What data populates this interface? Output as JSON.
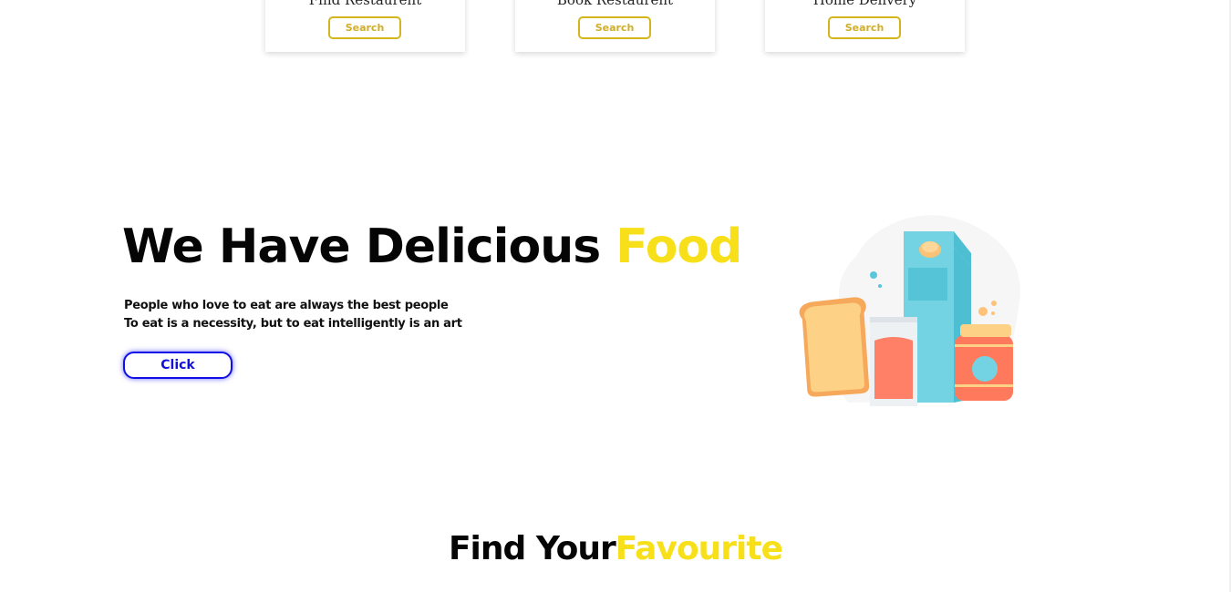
{
  "services": [
    {
      "title": "Find Restaurent",
      "button": "Search"
    },
    {
      "title": "Book Restaurent",
      "button": "Search"
    },
    {
      "title": "Home Delivery",
      "button": "Search"
    }
  ],
  "hero": {
    "title_main": "We Have Delicious ",
    "title_accent": "Food",
    "line1": "People who love to eat are always the best people",
    "line2": "To eat is a necessity, but to eat intelligently is an art",
    "button": "Click"
  },
  "section": {
    "title_main": "Find Your",
    "title_accent": "Favourite"
  },
  "colors": {
    "accent": "#f7e01a",
    "button_border": "#1010e6",
    "card_button": "#d4b61c"
  },
  "icons": {
    "illustration": "grocery-illustration"
  }
}
